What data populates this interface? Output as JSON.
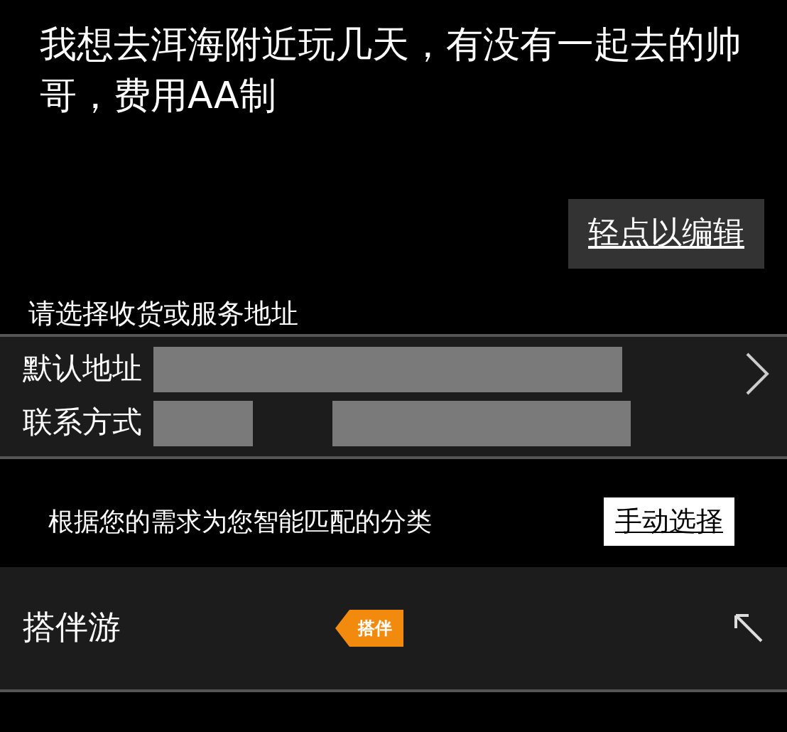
{
  "message": "我想去洱海附近玩几天，有没有一起去的帅哥，费用AA制",
  "edit_button": "轻点以编辑",
  "address_prompt": "请选择收货或服务地址",
  "address_rows": [
    {
      "label": "默认地址"
    },
    {
      "label": "联系方式"
    }
  ],
  "category_hint": "根据您的需求为您智能匹配的分类",
  "manual_button": "手动选择",
  "category": {
    "name": "搭伴游",
    "tag": "搭伴"
  }
}
